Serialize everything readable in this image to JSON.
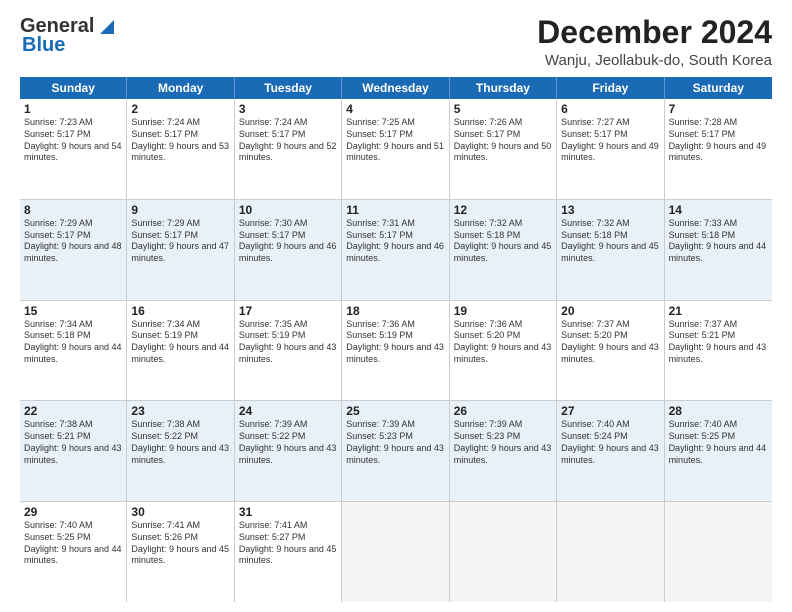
{
  "header": {
    "logo_line1": "General",
    "logo_line2": "Blue",
    "title": "December 2024",
    "subtitle": "Wanju, Jeollabuk-do, South Korea"
  },
  "days_of_week": [
    "Sunday",
    "Monday",
    "Tuesday",
    "Wednesday",
    "Thursday",
    "Friday",
    "Saturday"
  ],
  "weeks": [
    [
      {
        "day": "1",
        "sunrise": "7:23 AM",
        "sunset": "5:17 PM",
        "daylight": "9 hours and 54 minutes."
      },
      {
        "day": "2",
        "sunrise": "7:24 AM",
        "sunset": "5:17 PM",
        "daylight": "9 hours and 53 minutes."
      },
      {
        "day": "3",
        "sunrise": "7:24 AM",
        "sunset": "5:17 PM",
        "daylight": "9 hours and 52 minutes."
      },
      {
        "day": "4",
        "sunrise": "7:25 AM",
        "sunset": "5:17 PM",
        "daylight": "9 hours and 51 minutes."
      },
      {
        "day": "5",
        "sunrise": "7:26 AM",
        "sunset": "5:17 PM",
        "daylight": "9 hours and 50 minutes."
      },
      {
        "day": "6",
        "sunrise": "7:27 AM",
        "sunset": "5:17 PM",
        "daylight": "9 hours and 49 minutes."
      },
      {
        "day": "7",
        "sunrise": "7:28 AM",
        "sunset": "5:17 PM",
        "daylight": "9 hours and 49 minutes."
      }
    ],
    [
      {
        "day": "8",
        "sunrise": "7:29 AM",
        "sunset": "5:17 PM",
        "daylight": "9 hours and 48 minutes."
      },
      {
        "day": "9",
        "sunrise": "7:29 AM",
        "sunset": "5:17 PM",
        "daylight": "9 hours and 47 minutes."
      },
      {
        "day": "10",
        "sunrise": "7:30 AM",
        "sunset": "5:17 PM",
        "daylight": "9 hours and 46 minutes."
      },
      {
        "day": "11",
        "sunrise": "7:31 AM",
        "sunset": "5:17 PM",
        "daylight": "9 hours and 46 minutes."
      },
      {
        "day": "12",
        "sunrise": "7:32 AM",
        "sunset": "5:18 PM",
        "daylight": "9 hours and 45 minutes."
      },
      {
        "day": "13",
        "sunrise": "7:32 AM",
        "sunset": "5:18 PM",
        "daylight": "9 hours and 45 minutes."
      },
      {
        "day": "14",
        "sunrise": "7:33 AM",
        "sunset": "5:18 PM",
        "daylight": "9 hours and 44 minutes."
      }
    ],
    [
      {
        "day": "15",
        "sunrise": "7:34 AM",
        "sunset": "5:18 PM",
        "daylight": "9 hours and 44 minutes."
      },
      {
        "day": "16",
        "sunrise": "7:34 AM",
        "sunset": "5:19 PM",
        "daylight": "9 hours and 44 minutes."
      },
      {
        "day": "17",
        "sunrise": "7:35 AM",
        "sunset": "5:19 PM",
        "daylight": "9 hours and 43 minutes."
      },
      {
        "day": "18",
        "sunrise": "7:36 AM",
        "sunset": "5:19 PM",
        "daylight": "9 hours and 43 minutes."
      },
      {
        "day": "19",
        "sunrise": "7:36 AM",
        "sunset": "5:20 PM",
        "daylight": "9 hours and 43 minutes."
      },
      {
        "day": "20",
        "sunrise": "7:37 AM",
        "sunset": "5:20 PM",
        "daylight": "9 hours and 43 minutes."
      },
      {
        "day": "21",
        "sunrise": "7:37 AM",
        "sunset": "5:21 PM",
        "daylight": "9 hours and 43 minutes."
      }
    ],
    [
      {
        "day": "22",
        "sunrise": "7:38 AM",
        "sunset": "5:21 PM",
        "daylight": "9 hours and 43 minutes."
      },
      {
        "day": "23",
        "sunrise": "7:38 AM",
        "sunset": "5:22 PM",
        "daylight": "9 hours and 43 minutes."
      },
      {
        "day": "24",
        "sunrise": "7:39 AM",
        "sunset": "5:22 PM",
        "daylight": "9 hours and 43 minutes."
      },
      {
        "day": "25",
        "sunrise": "7:39 AM",
        "sunset": "5:23 PM",
        "daylight": "9 hours and 43 minutes."
      },
      {
        "day": "26",
        "sunrise": "7:39 AM",
        "sunset": "5:23 PM",
        "daylight": "9 hours and 43 minutes."
      },
      {
        "day": "27",
        "sunrise": "7:40 AM",
        "sunset": "5:24 PM",
        "daylight": "9 hours and 43 minutes."
      },
      {
        "day": "28",
        "sunrise": "7:40 AM",
        "sunset": "5:25 PM",
        "daylight": "9 hours and 44 minutes."
      }
    ],
    [
      {
        "day": "29",
        "sunrise": "7:40 AM",
        "sunset": "5:25 PM",
        "daylight": "9 hours and 44 minutes."
      },
      {
        "day": "30",
        "sunrise": "7:41 AM",
        "sunset": "5:26 PM",
        "daylight": "9 hours and 45 minutes."
      },
      {
        "day": "31",
        "sunrise": "7:41 AM",
        "sunset": "5:27 PM",
        "daylight": "9 hours and 45 minutes."
      },
      null,
      null,
      null,
      null
    ]
  ],
  "row_styles": [
    "white",
    "alt",
    "white",
    "alt",
    "white"
  ]
}
